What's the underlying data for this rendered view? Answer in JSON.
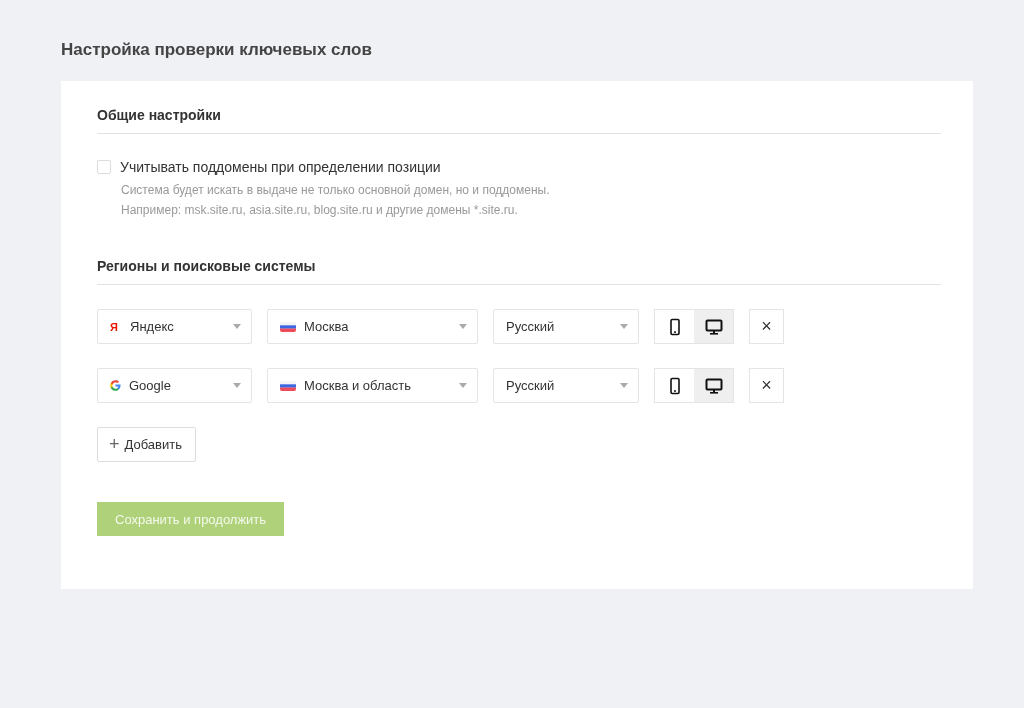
{
  "title": "Настройка проверки ключевых слов",
  "general": {
    "heading": "Общие настройки",
    "option": {
      "label": "Учитывать поддомены при определении позиции",
      "checked": false,
      "hint_lines": [
        "Система будет искать в выдаче не только основной домен, но и поддомены.",
        "Например: msk.site.ru, asia.site.ru, blog.site.ru и другие домены *.site.ru."
      ]
    }
  },
  "regions": {
    "heading": "Регионы и поисковые системы",
    "rows": [
      {
        "engine": {
          "kind": "yandex",
          "logo": "Я",
          "label": "Яндекс"
        },
        "region": "Москва",
        "language": "Русский",
        "devices": [
          {
            "kind": "mobile",
            "selected": false
          },
          {
            "kind": "desktop",
            "selected": true
          }
        ],
        "remove": "×"
      },
      {
        "engine": {
          "kind": "google",
          "label": "Google"
        },
        "region": "Москва и область",
        "language": "Русский",
        "devices": [
          {
            "kind": "mobile",
            "selected": false
          },
          {
            "kind": "desktop",
            "selected": true
          }
        ],
        "remove": "×"
      }
    ],
    "add_button": {
      "icon": "+",
      "label": "Добавить"
    }
  },
  "save_button": {
    "label": "Сохранить и продолжить",
    "disabled": true
  }
}
